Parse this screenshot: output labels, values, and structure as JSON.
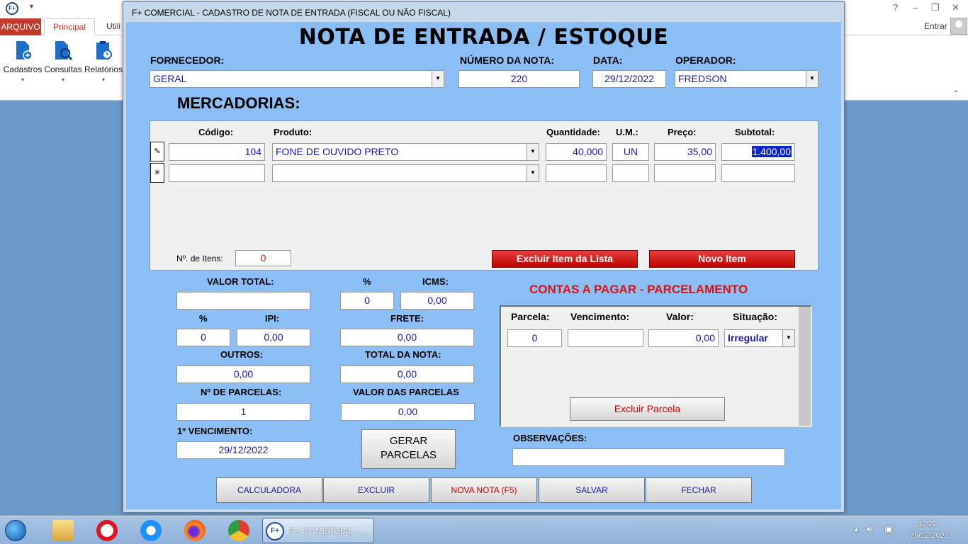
{
  "background_app": {
    "tabs": {
      "arquivo": "ARQUIVO",
      "principal": "Principal",
      "util": "Utili"
    },
    "ribbon_buttons": [
      "Cadastros",
      "Consultas",
      "Relatórios"
    ],
    "signin": "Entrar",
    "window_controls": {
      "help": "?",
      "minimize": "–",
      "restore": "❐",
      "close": "✕"
    }
  },
  "dialog": {
    "window_title": "F+ COMERCIAL - CADASTRO DE NOTA DE ENTRADA (FISCAL OU NÃO FISCAL)",
    "heading": "NOTA DE ENTRADA / ESTOQUE",
    "fornecedor": {
      "label": "FORNECEDOR:",
      "value": "GERAL"
    },
    "numero_nota": {
      "label": "NÚMERO DA NOTA:",
      "value": "220"
    },
    "data": {
      "label": "DATA:",
      "value": "29/12/2022"
    },
    "operador": {
      "label": "OPERADOR:",
      "value": "FREDSON"
    },
    "mercadorias_label": "MERCADORIAS:",
    "grid": {
      "columns": [
        "Código:",
        "Produto:",
        "Quantidade:",
        "U.M.:",
        "Preço:",
        "Subtotal:"
      ],
      "rows": [
        {
          "selector": "✎",
          "codigo": "104",
          "produto": "FONE DE OUVIDO PRETO",
          "quantidade": "40,000",
          "um": "UN",
          "preco": "35,00",
          "subtotal": "1.400,00"
        },
        {
          "selector": "✳",
          "codigo": "",
          "produto": "",
          "quantidade": "",
          "um": "",
          "preco": "",
          "subtotal": ""
        }
      ],
      "item_count_label": "Nº. de Itens:",
      "item_count": "0",
      "excluir_item": "Excluir Item da Lista",
      "novo_item": "Novo Item"
    },
    "totals": {
      "valor_total_label": "VALOR TOTAL:",
      "valor_total": "",
      "icms_pct_label": "%",
      "icms_pct": "0",
      "icms_label": "ICMS:",
      "icms": "0,00",
      "ipi_pct_label": "%",
      "ipi_pct": "0",
      "ipi_label": "IPI:",
      "ipi": "0,00",
      "frete_label": "FRETE:",
      "frete": "0,00",
      "outros_label": "OUTROS:",
      "outros": "0,00",
      "total_nota_label": "TOTAL DA NOTA:",
      "total_nota": "0,00",
      "num_parcelas_label": "Nº DE PARCELAS:",
      "num_parcelas": "1",
      "valor_parcelas_label": "VALOR DAS PARCELAS",
      "valor_parcelas": "0,00",
      "primeiro_venc_label": "1º VENCIMENTO:",
      "primeiro_venc": "29/12/2022",
      "gerar_parcelas_1": "GERAR",
      "gerar_parcelas_2": "PARCELAS"
    },
    "contas": {
      "title": "CONTAS A PAGAR - PARCELAMENTO",
      "columns": [
        "Parcela:",
        "Vencimento:",
        "Valor:",
        "Situação:"
      ],
      "row": {
        "parcela": "0",
        "vencimento": "",
        "valor": "0,00",
        "situacao": "Irregular"
      },
      "excluir_parcela": "Excluir Parcela"
    },
    "observacoes_label": "OBSERVAÇÕES:",
    "observacoes": "",
    "buttons": {
      "calculadora": "CALCULADORA",
      "excluir": "EXCLUIR",
      "nova_nota": "NOVA NOTA (F5)",
      "salvar": "SALVAR",
      "fechar": "FECHAR"
    }
  },
  "taskbar": {
    "active_window": "F+ COMERCIAL - ...",
    "time": "12:22",
    "date": "29/12/2022"
  },
  "colors": {
    "dialog_bg": "#8bbef5",
    "accent_red": "#e01010",
    "field_text": "#1a1ab0",
    "selection": "#0a24d6"
  }
}
